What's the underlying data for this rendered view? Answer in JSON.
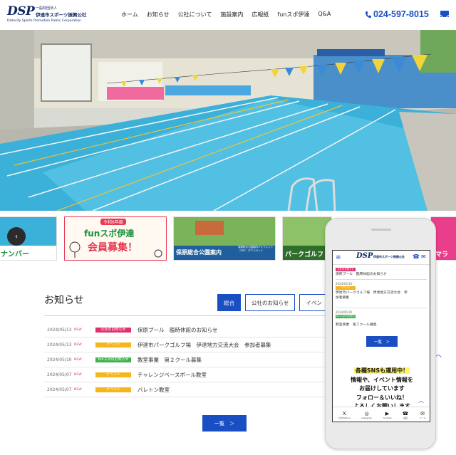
{
  "header": {
    "logo": {
      "mark": "DSP",
      "org_type": "一般財団法人",
      "org_name": "伊達市スポーツ振興公社",
      "org_en": "Datecity Sports Promotion Public Corporation"
    },
    "nav": [
      "ホーム",
      "お知らせ",
      "公社について",
      "施設案内",
      "広報紙",
      "funスポ伊達",
      "Q&A"
    ],
    "phone": "024-597-8015",
    "mail_icon": "mail-icon"
  },
  "banners": {
    "left_partial": "ナンバー",
    "fun": {
      "era": "令和6年度",
      "title1": "funスポ伊達",
      "title2": "会員募集！"
    },
    "park": {
      "title": "保原総合公園案内",
      "sub": "保原総合公園園内パンフレット（PDF）ダウンロード"
    },
    "golf": {
      "title": "パークゴルフ"
    },
    "right_partial": "マラ"
  },
  "news": {
    "heading": "お知らせ",
    "tabs": [
      "総合",
      "公社のお知らせ",
      "イベン"
    ],
    "items": [
      {
        "date": "2024/05/13",
        "new": "NEW",
        "badge": "公社のお知らせ",
        "badge_color": "#e0306d",
        "title": "保原プール　臨時休館のお知らせ"
      },
      {
        "date": "2024/05/13",
        "new": "NEW",
        "badge": "イベント",
        "badge_color": "#f5b51b",
        "title": "伊達市パークゴルフ場　伊達地方交流大会　参加者募集"
      },
      {
        "date": "2024/05/10",
        "new": "NEW",
        "badge": "funスポのお知らせ",
        "badge_color": "#3ab44a",
        "title": "教室事業　第２クール募集"
      },
      {
        "date": "2024/05/07",
        "new": "NEW",
        "badge": "イベント",
        "badge_color": "#f5b51b",
        "title": "チャレンジベースボール教室"
      },
      {
        "date": "2024/05/07",
        "new": "NEW",
        "badge": "イベント",
        "badge_color": "#f5b51b",
        "title": "バレトン教室"
      }
    ],
    "more": "一覧　＞"
  },
  "mobile": {
    "logo_mark": "DSP",
    "logo_org": "伊達市スポーツ振興公社",
    "rows": [
      {
        "badge": "公社のお知らせ",
        "badge_color": "#e0306d",
        "title": "保原プール　臨時休館のお知らせ"
      },
      {
        "date": "2024/05/13",
        "badge": "イベント",
        "badge_color": "#f5b51b",
        "title": "伊達市パークゴルフ場　伊達地方交流大会　参",
        "title2": "加者募集"
      },
      {
        "date": "2024/05/10",
        "badge": "funスポのお知らせ",
        "badge_color": "#3ab44a",
        "title": "教室事業　第２クール募集"
      }
    ],
    "more": "一覧　＞",
    "sns": {
      "line1": "各種SNSも運用中！",
      "line2": "情報や、イベント情報を",
      "line3": "お届けしています",
      "line4": "フォロー＆いいね！",
      "line5": "よろしくお願いします"
    },
    "footer": [
      {
        "icon": "X",
        "label": "X(旧Twitter)"
      },
      {
        "icon": "◎",
        "label": "Instagram"
      },
      {
        "icon": "▶",
        "label": "YouTube"
      },
      {
        "icon": "☎",
        "label": "電話"
      },
      {
        "icon": "✉",
        "label": "メール"
      }
    ]
  },
  "colors": {
    "accent": "#1a4fc4",
    "navy": "#102a66"
  }
}
